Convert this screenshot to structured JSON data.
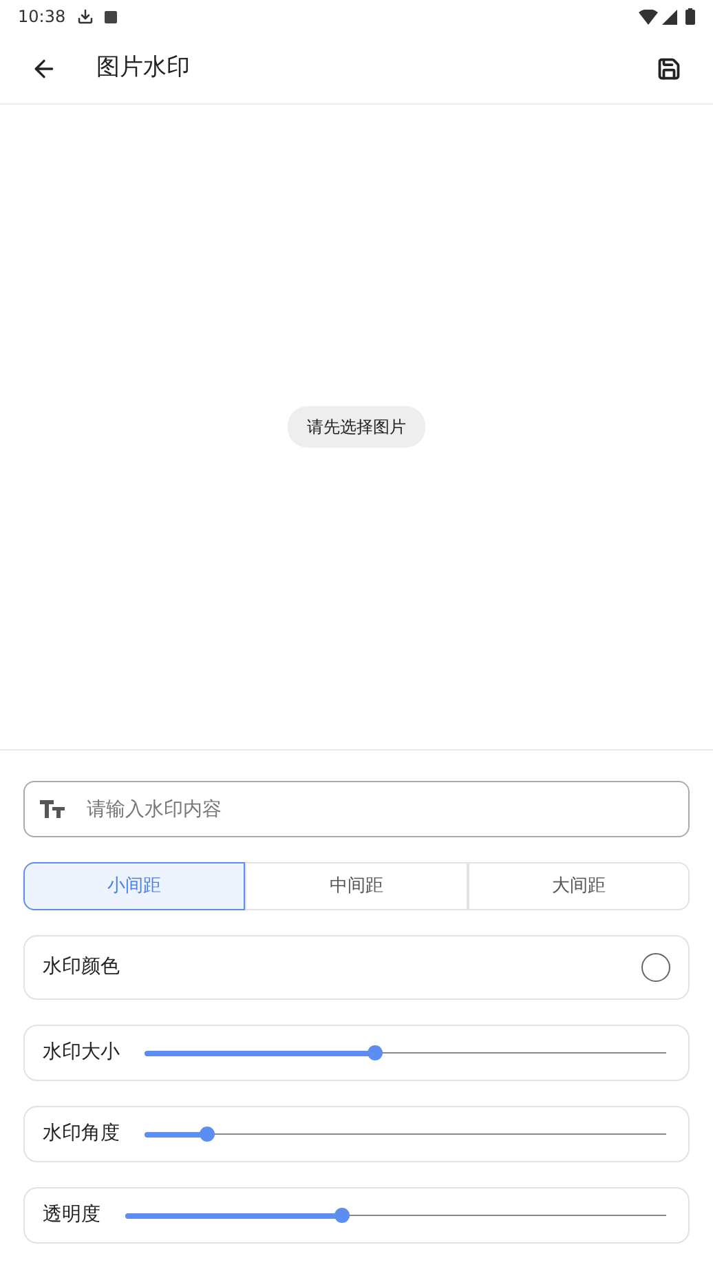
{
  "status_bar": {
    "time": "10:38"
  },
  "app_bar": {
    "title": "图片水印"
  },
  "preview": {
    "hint": "请先选择图片"
  },
  "text_field": {
    "placeholder": "请输入水印内容"
  },
  "spacing_tabs": [
    {
      "label": "小间距",
      "selected": true
    },
    {
      "label": "中间距",
      "selected": false
    },
    {
      "label": "大间距",
      "selected": false
    }
  ],
  "color_row": {
    "label": "水印颜色"
  },
  "sliders": [
    {
      "label": "水印大小",
      "level": 0.44
    },
    {
      "label": "水印角度",
      "level": 0.12
    },
    {
      "label": "透明度",
      "level": 0.4
    }
  ]
}
